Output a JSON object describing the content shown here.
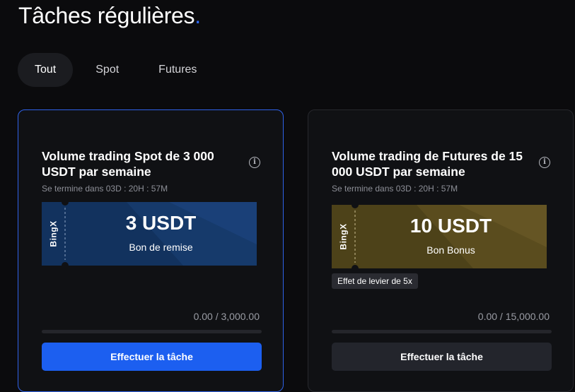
{
  "page": {
    "title": "Tâches régulières",
    "title_dot": "."
  },
  "tabs": [
    {
      "label": "Tout",
      "active": true
    },
    {
      "label": "Spot",
      "active": false
    },
    {
      "label": "Futures",
      "active": false
    }
  ],
  "cards": [
    {
      "title": "Volume trading Spot de 3 000 USDT par semaine",
      "deadline": "Se termine dans 03D : 20H : 57M",
      "coupon": {
        "brand": "BingX",
        "amount": "3 USDT",
        "kind": "Bon de remise",
        "color": "#12325e"
      },
      "progress_text": "0.00 / 3,000.00",
      "progress_fraction": 0,
      "cta": "Effectuer la tâche",
      "cta_color": "#1c5ff0"
    },
    {
      "title": "Volume trading de Futures de 15 000 USDT par semaine",
      "deadline": "Se termine dans 03D : 20H : 57M",
      "coupon": {
        "brand": "BingX",
        "amount": "10 USDT",
        "kind": "Bon Bonus",
        "color": "#5a4c1e"
      },
      "tag": "Effet de levier de 5x",
      "progress_text": "0.00 / 15,000.00",
      "progress_fraction": 0,
      "cta": "Effectuer la tâche",
      "cta_color": "#23252c"
    }
  ],
  "colors": {
    "accent": "#2f6bff",
    "background": "#0b0b0d"
  }
}
